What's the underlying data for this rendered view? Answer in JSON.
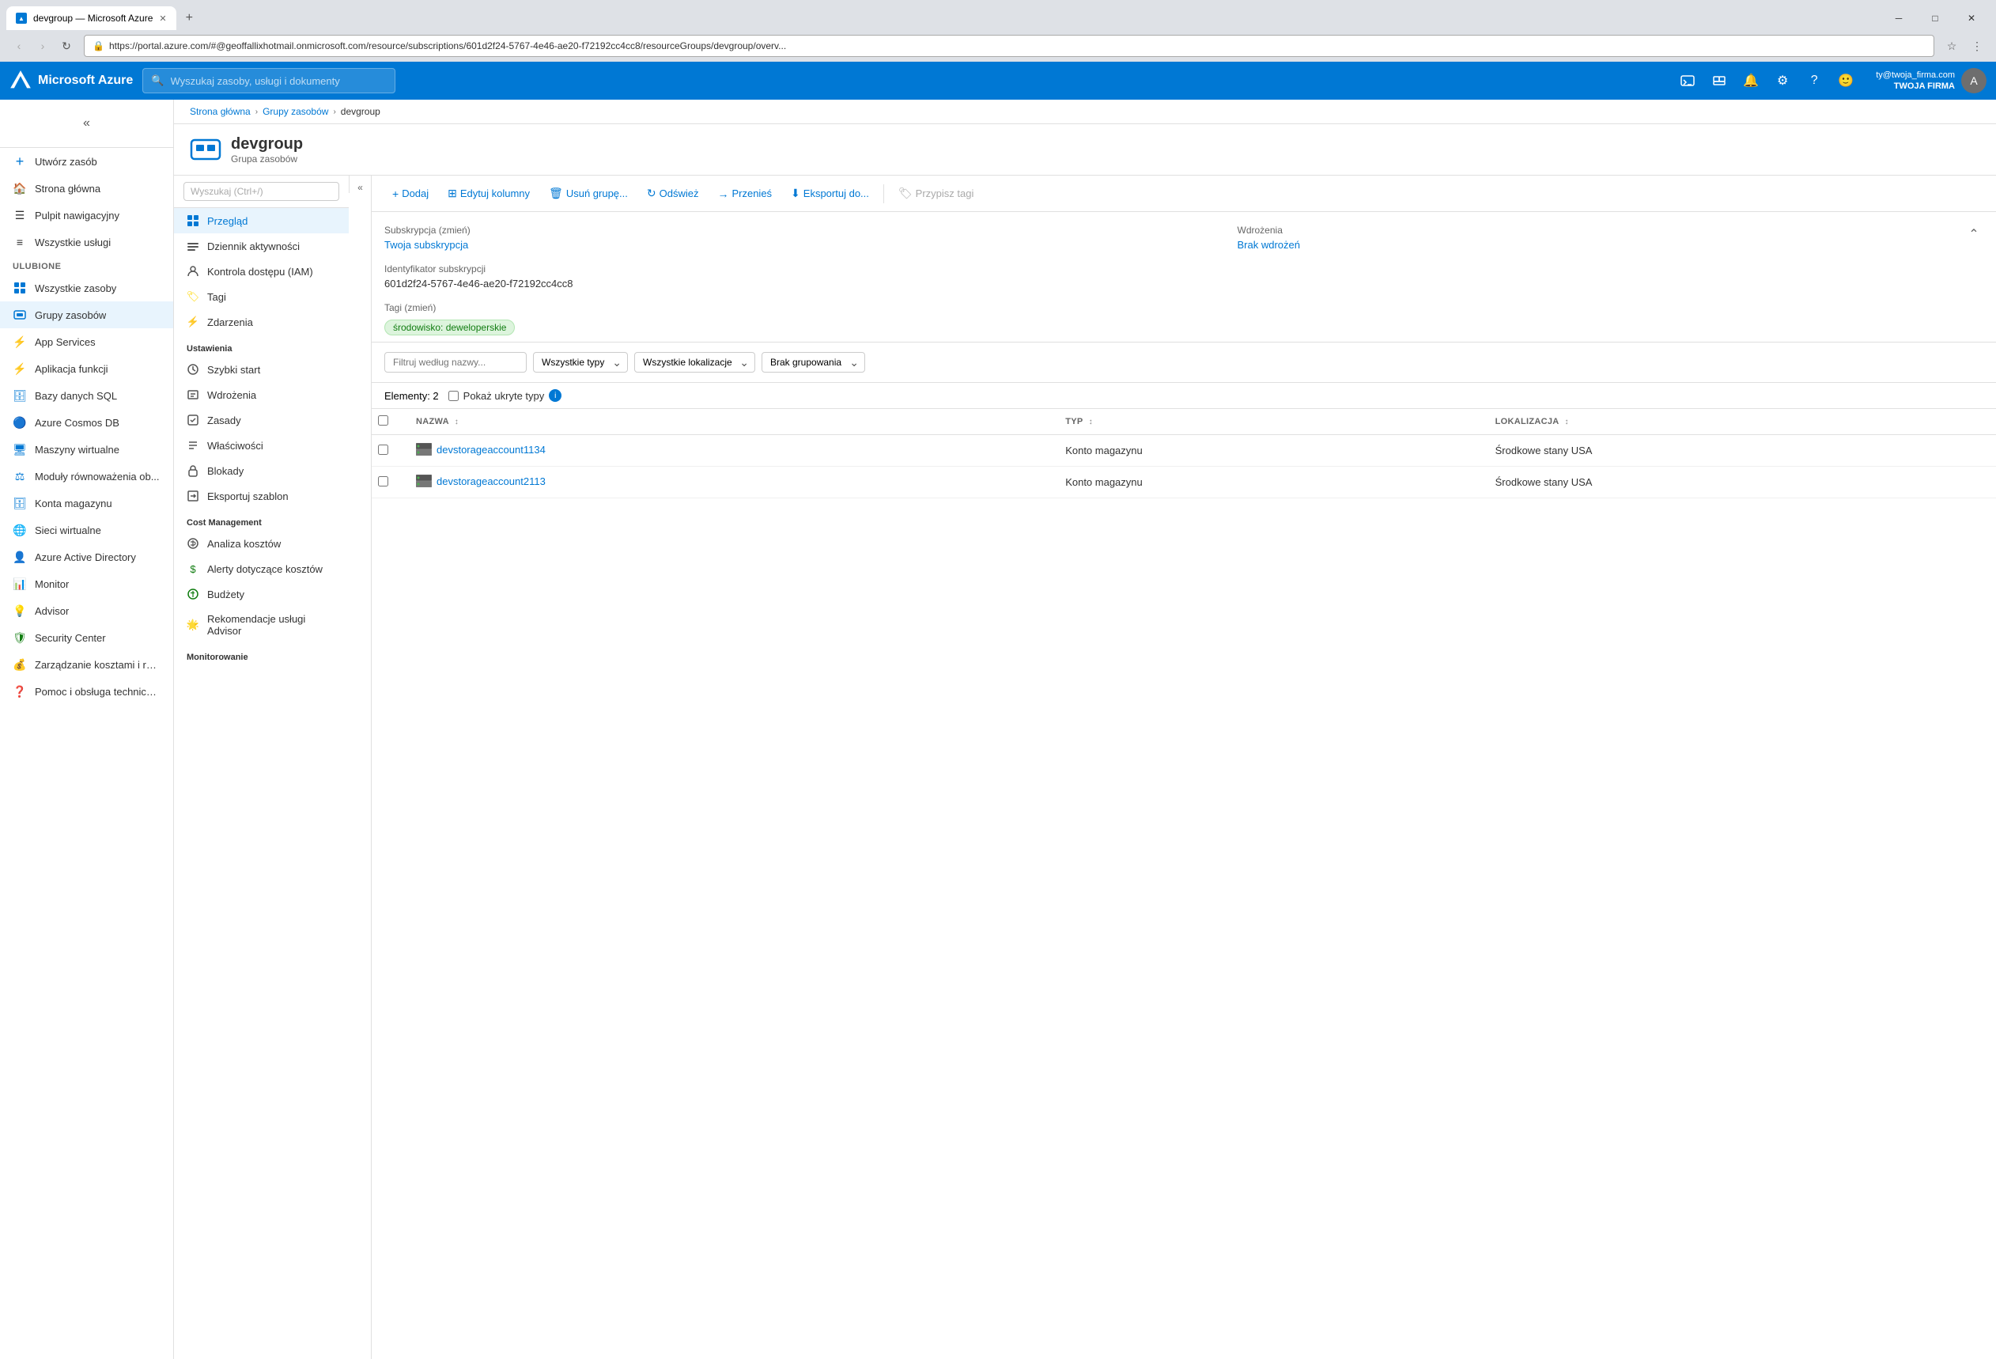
{
  "browser": {
    "tab_title": "devgroup — Microsoft Azure",
    "url": "https://portal.azure.com/#@geoffallixhotmail.onmicrosoft.com/resource/subscriptions/601d2f24-5767-4e46-ae20-f72192cc4cc8/resourceGroups/devgroup/overv...",
    "new_tab_label": "+"
  },
  "window_controls": {
    "minimize": "─",
    "maximize": "□",
    "close": "✕"
  },
  "topbar": {
    "brand": "Microsoft Azure",
    "search_placeholder": "Wyszukaj zasoby, usługi i dokumenty",
    "user_email": "ty@twoja_firma.com",
    "user_company": "TWOJA FIRMA"
  },
  "breadcrumb": {
    "home": "Strona główna",
    "groups": "Grupy zasobów",
    "current": "devgroup"
  },
  "sidebar": {
    "collapse_label": "«",
    "create_label": "Utwórz zasób",
    "home_label": "Strona główna",
    "dashboard_label": "Pulpit nawigacyjny",
    "all_services_label": "Wszystkie usługi",
    "favorites_section": "ULUBIONE",
    "items": [
      {
        "label": "Wszystkie zasoby",
        "icon": "☰"
      },
      {
        "label": "Grupy zasobów",
        "icon": "⬛"
      },
      {
        "label": "App Services",
        "icon": "⚡"
      },
      {
        "label": "Aplikacja funkcji",
        "icon": "⚡"
      },
      {
        "label": "Bazy danych SQL",
        "icon": "🗄"
      },
      {
        "label": "Azure Cosmos DB",
        "icon": "🔵"
      },
      {
        "label": "Maszyny wirtualne",
        "icon": "🖥"
      },
      {
        "label": "Moduły równoważenia ob...",
        "icon": "⚖"
      },
      {
        "label": "Konta magazynu",
        "icon": "🗄"
      },
      {
        "label": "Sieci wirtualne",
        "icon": "🌐"
      },
      {
        "label": "Azure Active Directory",
        "icon": "👤"
      },
      {
        "label": "Monitor",
        "icon": "📊"
      },
      {
        "label": "Advisor",
        "icon": "💡"
      },
      {
        "label": "Security Center",
        "icon": "🛡"
      },
      {
        "label": "Zarządzanie kosztami i roz...",
        "icon": "💰"
      },
      {
        "label": "Pomoc i obsługa techniczna",
        "icon": "❓"
      }
    ]
  },
  "resource": {
    "name": "devgroup",
    "type": "Grupa zasobów"
  },
  "sub_panel": {
    "search_placeholder": "Wyszukaj (Ctrl+/)",
    "collapse_icon": "«",
    "nav_items": [
      {
        "label": "Przegląd",
        "section": ""
      },
      {
        "label": "Dziennik aktywności",
        "section": ""
      },
      {
        "label": "Kontrola dostępu (IAM)",
        "section": ""
      },
      {
        "label": "Tagi",
        "section": ""
      },
      {
        "label": "Zdarzenia",
        "section": ""
      }
    ],
    "settings_section": "Ustawienia",
    "settings_items": [
      {
        "label": "Szybki start"
      },
      {
        "label": "Wdrożenia"
      },
      {
        "label": "Zasady"
      },
      {
        "label": "Właściwości"
      },
      {
        "label": "Blokady"
      },
      {
        "label": "Eksportuj szablon"
      }
    ],
    "cost_section": "Cost Management",
    "cost_items": [
      {
        "label": "Analiza kosztów"
      },
      {
        "label": "Alerty dotyczące kosztów"
      },
      {
        "label": "Budżety"
      },
      {
        "label": "Rekomendacje usługi Advisor"
      }
    ],
    "monitoring_section": "Monitorowanie"
  },
  "toolbar": {
    "add_label": "Dodaj",
    "edit_columns_label": "Edytuj kolumny",
    "delete_group_label": "Usuń grupę...",
    "refresh_label": "Odśwież",
    "move_label": "Przenieś",
    "export_label": "Eksportuj do...",
    "assign_tags_label": "Przypisz tagi"
  },
  "subscription_info": {
    "subscription_label": "Subskrypcja (zmień)",
    "subscription_value": "Twoja subskrypcja",
    "subscription_id_label": "Identyfikator subskrypcji",
    "subscription_id_value": "601d2f24-5767-4e46-ae20-f72192cc4cc8",
    "tags_label": "Tagi (zmień)",
    "tag_value": "środowisko: deweloperskie",
    "deployments_label": "Wdrożenia",
    "deployments_value": "Brak wdrożeń"
  },
  "filters": {
    "filter_placeholder": "Filtruj według nazwy...",
    "type_all": "Wszystkie typy",
    "location_all": "Wszystkie lokalizacje",
    "grouping_none": "Brak grupowania",
    "items_count": "Elementy: 2",
    "show_hidden_label": "Pokaż ukryte typy"
  },
  "table": {
    "col_name": "NAZWA",
    "col_type": "TYP",
    "col_location": "LOKALIZACJA",
    "rows": [
      {
        "name": "devstorageaccount1134",
        "type": "Konto magazynu",
        "location": "Środkowe stany USA"
      },
      {
        "name": "devstorageaccount2113",
        "type": "Konto magazynu",
        "location": "Środkowe stany USA"
      }
    ]
  },
  "colors": {
    "azure_blue": "#0078d4",
    "green": "#107c10",
    "light_blue": "#e8f4fd"
  }
}
